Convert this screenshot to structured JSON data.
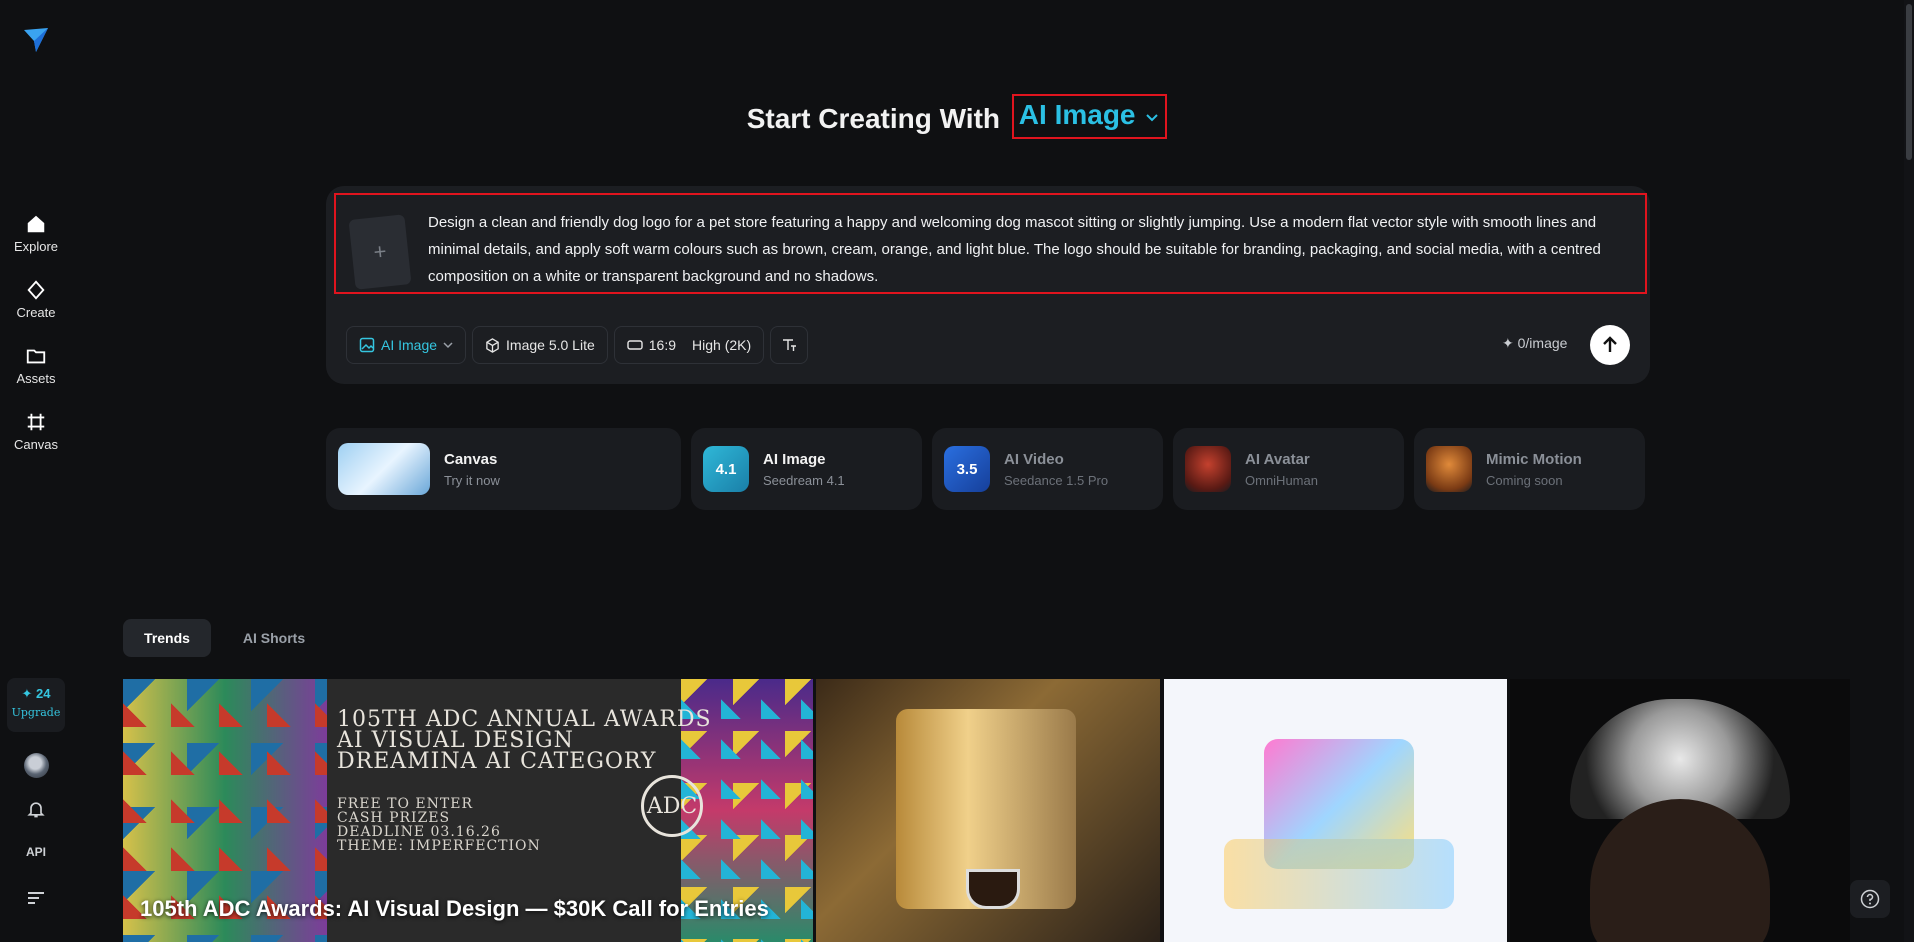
{
  "sidebar": {
    "items": [
      {
        "label": "Explore",
        "icon": "home-icon"
      },
      {
        "label": "Create",
        "icon": "diamond-icon"
      },
      {
        "label": "Assets",
        "icon": "folder-icon"
      },
      {
        "label": "Canvas",
        "icon": "canvas-icon"
      }
    ],
    "credits": {
      "count": "✦ 24",
      "upgrade": "Upgrade"
    },
    "api_label": "API"
  },
  "header": {
    "title_prefix": "Start Creating With",
    "mode": "AI Image"
  },
  "prompt": {
    "text": "Design a clean and friendly dog logo for a pet store featuring a happy and welcoming dog mascot sitting or slightly jumping. Use a modern flat vector style with smooth lines and minimal details, and apply soft warm colours such as brown, cream, orange, and light blue. The logo should be suitable for branding, packaging, and social media, with a centred composition on a white or transparent background and no shadows.",
    "upload_glyph": "+"
  },
  "toolbar": {
    "mode": "AI Image",
    "model": "Image 5.0 Lite",
    "ratio": "16:9",
    "quality": "High (2K)",
    "cost": "✦ 0/image"
  },
  "cards": [
    {
      "title": "Canvas",
      "subtitle": "Try it now"
    },
    {
      "title": "AI Image",
      "subtitle": "Seedream 4.1",
      "icon_text": "4.1"
    },
    {
      "title": "AI Video",
      "subtitle": "Seedance 1.5 Pro",
      "icon_text": "3.5"
    },
    {
      "title": "AI Avatar",
      "subtitle": "OmniHuman"
    },
    {
      "title": "Mimic Motion",
      "subtitle": "Coming soon"
    }
  ],
  "tabs": [
    "Trends",
    "AI Shorts"
  ],
  "gallery": {
    "featured": {
      "lines": [
        "105TH ADC ANNUAL AWARDS",
        "AI VISUAL DESIGN",
        "DREAMINA AI CATEGORY"
      ],
      "sub_lines": [
        "FREE TO ENTER",
        "CASH PRIZES",
        "DEADLINE 03.16.26",
        "THEME: IMPERFECTION"
      ],
      "badge": "ADC",
      "caption": "105th ADC Awards: AI Visual Design — $30K Call for Entries"
    }
  },
  "colors": {
    "accent": "#2bc0e4",
    "highlight_border": "#e0141e",
    "background": "#0f1012",
    "panel": "#1c1e22"
  }
}
